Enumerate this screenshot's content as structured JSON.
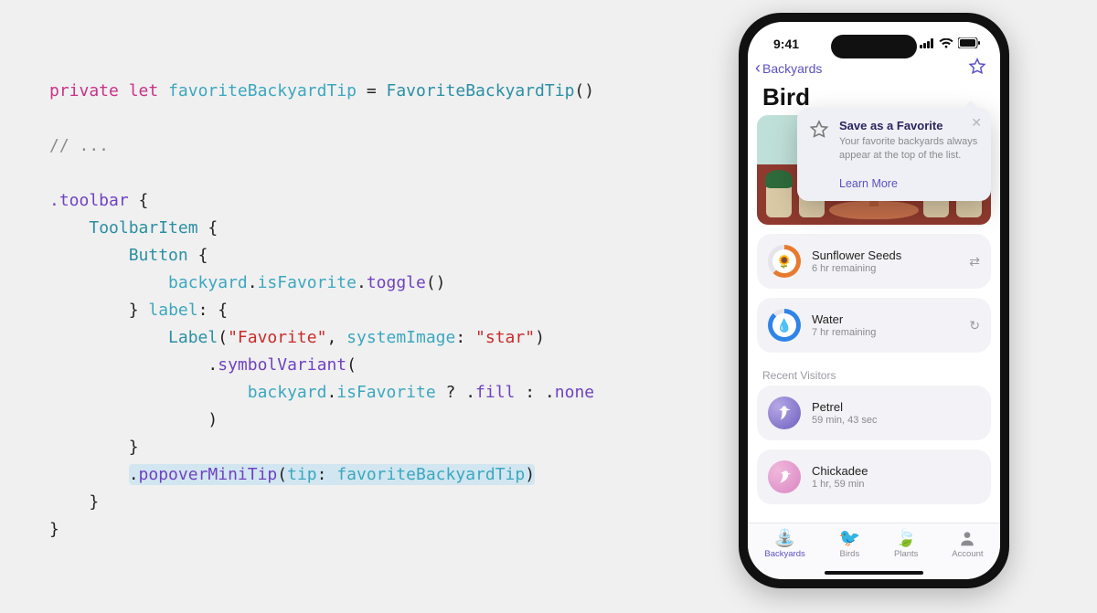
{
  "code": {
    "kw_private": "private",
    "kw_let": "let",
    "var_name": "favoriteBackyardTip",
    "eq": "=",
    "type_init": "FavoriteBackyardTip",
    "parens": "()",
    "comment": "// ...",
    "toolbar": ".toolbar",
    "brace_open": "{",
    "brace_close": "}",
    "ToolbarItem": "ToolbarItem",
    "Button": "Button",
    "backyard": "backyard",
    "isFavorite": "isFavorite",
    "toggle": "toggle",
    "label_kw": "label",
    "colon": ":",
    "Label": "Label",
    "str_fav": "\"Favorite\"",
    "systemImage": "systemImage",
    "str_star": "\"star\"",
    "symbolVariant": "symbolVariant",
    "qmark": "?",
    "fill": "fill",
    "none": "none",
    "popoverMiniTip": "popoverMiniTip",
    "tip_arg": "tip",
    "close_paren": ")"
  },
  "phone": {
    "time": "9:41",
    "back_label": "Backyards",
    "title": "Bird...",
    "tip": {
      "title": "Save as a Favorite",
      "subtitle": "Your favorite backyards always appear at the top of the list.",
      "cta": "Learn More",
      "close": "✕"
    },
    "supply": {
      "seeds_title": "Sunflower Seeds",
      "seeds_sub": "6 hr remaining",
      "water_title": "Water",
      "water_sub": "7 hr remaining"
    },
    "section_visitors": "Recent Visitors",
    "visitors": {
      "v1_name": "Petrel",
      "v1_sub": "59 min, 43 sec",
      "v2_name": "Chickadee",
      "v2_sub": "1 hr, 59 min"
    },
    "tabs": {
      "t1": "Backyards",
      "t2": "Birds",
      "t3": "Plants",
      "t4": "Account"
    }
  }
}
